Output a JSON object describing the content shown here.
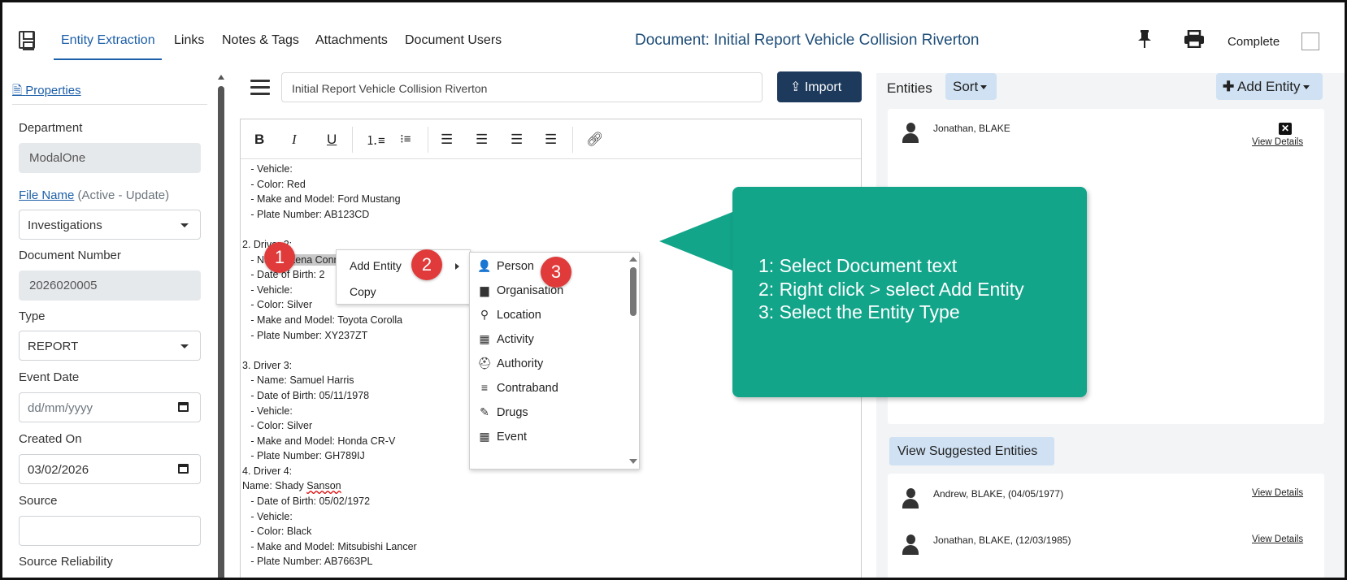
{
  "nav": {
    "tabs": [
      "Entity Extraction",
      "Links",
      "Notes & Tags",
      "Attachments",
      "Document Users"
    ],
    "document_title": "Document: Initial Report Vehicle Collision Riverton",
    "complete_label": "Complete"
  },
  "properties": {
    "link": "Properties",
    "department_label": "Department",
    "department_value": "ModalOne",
    "file_name_link": "File Name",
    "file_name_status": "(Active - Update)",
    "file_name_value": "Investigations",
    "doc_number_label": "Document Number",
    "doc_number_value": "2026020005",
    "type_label": "Type",
    "type_value": "REPORT",
    "event_date_label": "Event Date",
    "event_date_placeholder": "dd/mm/yyyy",
    "created_on_label": "Created On",
    "created_on_value": "03/02/2026",
    "source_label": "Source",
    "source_value": "",
    "source_reliability_label": "Source Reliability"
  },
  "editor": {
    "title_value": "Initial Report Vehicle Collision Riverton",
    "import_label": "Import",
    "toolbar": {
      "bold": "B",
      "italic": "I",
      "underline": "U"
    },
    "lines_pre": [
      "   - Vehicle:",
      "   - Color: Red",
      "   - Make and Model: Ford Mustang",
      "   - Plate Number: AB123CD",
      "",
      "2. Driver 2:"
    ],
    "selected_prefix": "   - Name: ",
    "selected_text": "Lena Conner",
    "lines_post": [
      "   - Date of Birth: 2",
      "   - Vehicle:",
      "   - Color: Silver",
      "   - Make and Model: Toyota Corolla",
      "   - Plate Number: XY237ZT",
      "",
      "3. Driver 3:",
      "   - Name: Samuel Harris",
      "   - Date of Birth: 05/11/1978",
      "   - Vehicle:",
      "   - Color: Silver",
      "   - Make and Model: Honda CR-V",
      "   - Plate Number: GH789IJ",
      "4. Driver 4:"
    ],
    "name_prefix": "Name: Shady ",
    "name_flagged": "Sanson",
    "lines_tail": [
      "   - Date of Birth: 05/02/1972",
      "   - Vehicle:",
      "   - Color: Black",
      "   - Make and Model: Mitsubishi Lancer",
      "   - Plate Number: AB7663PL"
    ]
  },
  "context_menu": {
    "add_entity": "Add Entity",
    "copy": "Copy"
  },
  "entity_types": [
    {
      "label": "Person",
      "icon": "person-icon",
      "glyph": "👤"
    },
    {
      "label": "Organisation",
      "icon": "organisation-icon",
      "glyph": "▆"
    },
    {
      "label": "Location",
      "icon": "location-icon",
      "glyph": "⚲"
    },
    {
      "label": "Activity",
      "icon": "activity-icon",
      "glyph": "▦"
    },
    {
      "label": "Authority",
      "icon": "authority-icon",
      "glyph": "⛑"
    },
    {
      "label": "Contraband",
      "icon": "contraband-icon",
      "glyph": "≡"
    },
    {
      "label": "Drugs",
      "icon": "drugs-icon",
      "glyph": "✎"
    },
    {
      "label": "Event",
      "icon": "event-icon",
      "glyph": "▦"
    }
  ],
  "badges": [
    "1",
    "2",
    "3"
  ],
  "callout": {
    "lines": [
      "1: Select Document text",
      "2: Right click > select Add Entity",
      "3: Select the Entity Type"
    ],
    "color": "#12a58a"
  },
  "entities": {
    "label": "Entities",
    "sort_label": "Sort",
    "add_label": "Add Entity",
    "items": [
      {
        "name": "Jonathan, BLAKE",
        "link": "View Details"
      }
    ],
    "suggested_label": "View Suggested Entities",
    "suggested": [
      {
        "name": "Andrew, BLAKE, (04/05/1977)",
        "link": "View Details"
      },
      {
        "name": "Jonathan, BLAKE, (12/03/1985)",
        "link": "View Details"
      }
    ]
  },
  "colors": {
    "accent": "#1d5fa8",
    "import_button": "#1d3a5c",
    "badge": "#e03a3a",
    "chip": "#cfe1f3"
  }
}
